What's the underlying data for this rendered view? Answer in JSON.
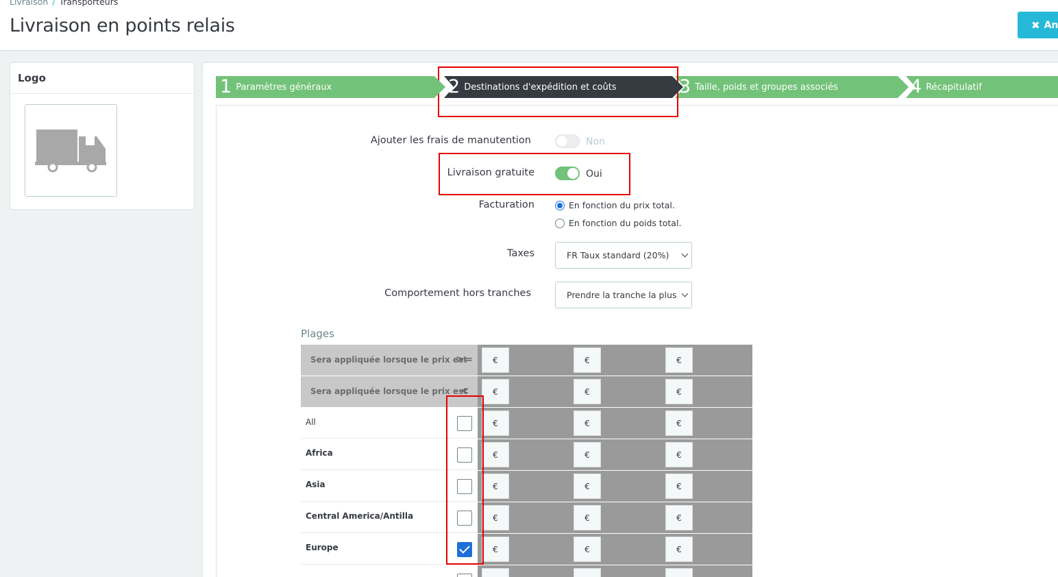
{
  "breadcrumb": {
    "parent": "Livraison",
    "separator": "/",
    "current": "Transporteurs"
  },
  "page": {
    "title": "Livraison en points relais",
    "cancel_label": "An"
  },
  "logo_panel": {
    "title": "Logo",
    "icon": "truck-icon"
  },
  "steps": [
    {
      "num": "1",
      "label": "Paramètres généraux",
      "active": false
    },
    {
      "num": "2",
      "label": "Destinations d'expédition et coûts",
      "active": true
    },
    {
      "num": "3",
      "label": "Taille, poids et groupes associés",
      "active": false
    },
    {
      "num": "4",
      "label": "Récapitulatif",
      "active": false
    }
  ],
  "form": {
    "handling_label": "Ajouter les frais de manutention",
    "handling_value": "Non",
    "free_shipping_label": "Livraison gratuite",
    "free_shipping_value": "Oui",
    "billing_label": "Facturation",
    "billing_option_price": "En fonction du prix total.",
    "billing_option_weight": "En fonction du poids total.",
    "taxes_label": "Taxes",
    "taxes_value": "FR Taux standard (20%)",
    "out_of_range_label": "Comportement hors tranches",
    "out_of_range_value": "Prendre la tranche la plus grande"
  },
  "plages": {
    "title": "Plages",
    "head_gte": {
      "label": "Sera appliquée lorsque le prix est",
      "symbol": ">="
    },
    "head_lt": {
      "label": "Sera appliquée lorsque le prix est",
      "symbol": "<"
    },
    "currency": "€",
    "zones": [
      {
        "name": "All",
        "checked": false,
        "bold": false
      },
      {
        "name": "Africa",
        "checked": false,
        "bold": true
      },
      {
        "name": "Asia",
        "checked": false,
        "bold": true
      },
      {
        "name": "Central America/Antilla",
        "checked": false,
        "bold": true
      },
      {
        "name": "Europe",
        "checked": true,
        "bold": true
      }
    ]
  },
  "colors": {
    "step_green": "#72c279",
    "step_active": "#363a41",
    "accent_blue": "#25b9d7",
    "highlight_red": "#e30000"
  }
}
